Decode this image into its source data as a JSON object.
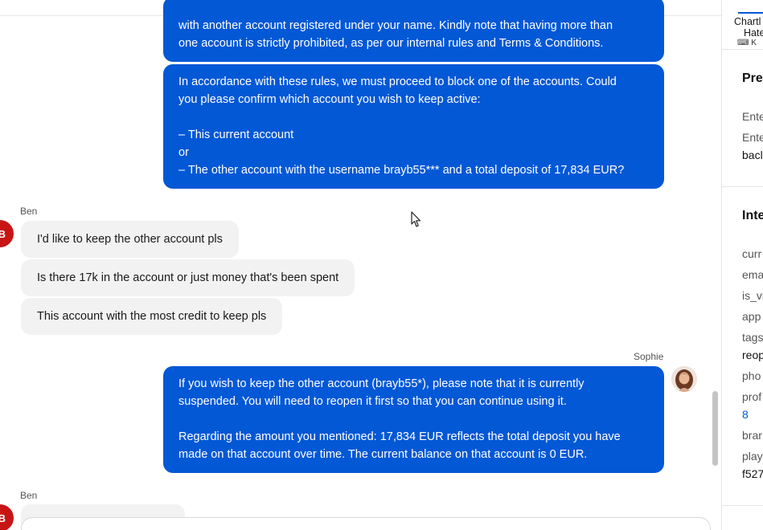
{
  "messages": {
    "agent_block_1": {
      "lines": [
        "with another account registered under your name. Kindly note that having more than",
        "one account is strictly prohibited, as per our internal rules and Terms & Conditions."
      ]
    },
    "agent_block_2": {
      "lines": [
        "In accordance with these rules, we must proceed to block one of the accounts. Could",
        "you please confirm which account you wish to keep active:",
        "",
        "– This current account",
        "or",
        "– The other account with the username brayb55*** and a total deposit of 17,834 EUR?"
      ]
    },
    "customer_group_1": {
      "sender": "Ben",
      "avatar_initial": "B",
      "messages": [
        "I'd like to keep the other account pls",
        "Is there 17k in the account or just money that's been spent",
        "This account with the most credit to keep pls"
      ]
    },
    "agent_block_3": {
      "sender": "Sophie",
      "lines": [
        "If you wish to keep the other account (brayb55*), please note that it is currently",
        "suspended. You will need to reopen it first so that you can continue using it.",
        "",
        "Regarding the amount you mentioned: 17,834 EUR reflects the total deposit you have",
        "made on that account over time. The current balance on that account is 0 EUR."
      ]
    },
    "customer_group_2": {
      "sender": "Ben",
      "avatar_initial": "B"
    }
  },
  "side_panel": {
    "tab_title_line1": "Chartl",
    "tab_title_line2": "Hate",
    "keyboard_hint": "⌨ K",
    "section1_title": "Pre",
    "section1_label1": "Ente",
    "section1_label2": "Ente",
    "section1_value2": "bacl",
    "section2_title": "Inte",
    "fields": [
      {
        "label": "curr",
        "value": ""
      },
      {
        "label": "ema",
        "value": ""
      },
      {
        "label": "is_vi",
        "value": ""
      },
      {
        "label": "app",
        "value": ""
      },
      {
        "label": "tags",
        "value": "reop"
      },
      {
        "label": "pho",
        "value": ""
      },
      {
        "label": "prof",
        "value": "8"
      },
      {
        "label": "brar",
        "value": ""
      },
      {
        "label": "play",
        "value": "f527"
      }
    ]
  },
  "colors": {
    "agent_bubble": "#0358d6",
    "customer_bubble": "#f2f2f2",
    "avatar_red": "#c71515"
  }
}
